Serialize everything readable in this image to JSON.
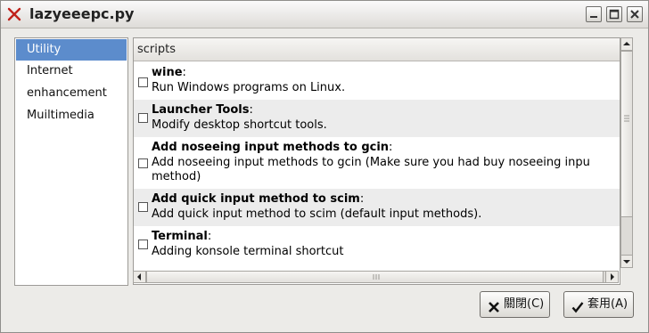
{
  "window": {
    "title": "lazyeeepc.py",
    "icon": "close-x-app-icon",
    "controls": [
      "minimize-icon",
      "maximize-icon",
      "close-icon"
    ]
  },
  "sidebar": {
    "items": [
      {
        "label": "Utility",
        "selected": true
      },
      {
        "label": "Internet",
        "selected": false
      },
      {
        "label": "enhancement",
        "selected": false
      },
      {
        "label": "Muiltimedia",
        "selected": false
      }
    ],
    "selected_color": "#5c8ccc"
  },
  "scripts": {
    "header": "scripts",
    "rows": [
      {
        "title": "wine",
        "colon": ":",
        "desc": [
          "Run Windows programs on Linux."
        ],
        "checked": false
      },
      {
        "title": "Launcher Tools",
        "colon": ":",
        "desc": [
          "Modify desktop shortcut tools."
        ],
        "checked": false
      },
      {
        "title": "Add noseeing input methods to gcin",
        "colon": ":",
        "desc": [
          "Add noseeing input methods to gcin (Make sure you had buy noseeing inpu",
          "method)"
        ],
        "checked": false
      },
      {
        "title": "Add quick input method to scim",
        "colon": ":",
        "desc": [
          "Add quick input method to scim (default input methods)."
        ],
        "checked": false
      },
      {
        "title": "Terminal",
        "colon": ":",
        "desc": [
          "Adding konsole terminal shortcut"
        ],
        "checked": false
      }
    ]
  },
  "buttons": {
    "cancel_label": "關閉(C)",
    "apply_label": "套用(A)"
  }
}
